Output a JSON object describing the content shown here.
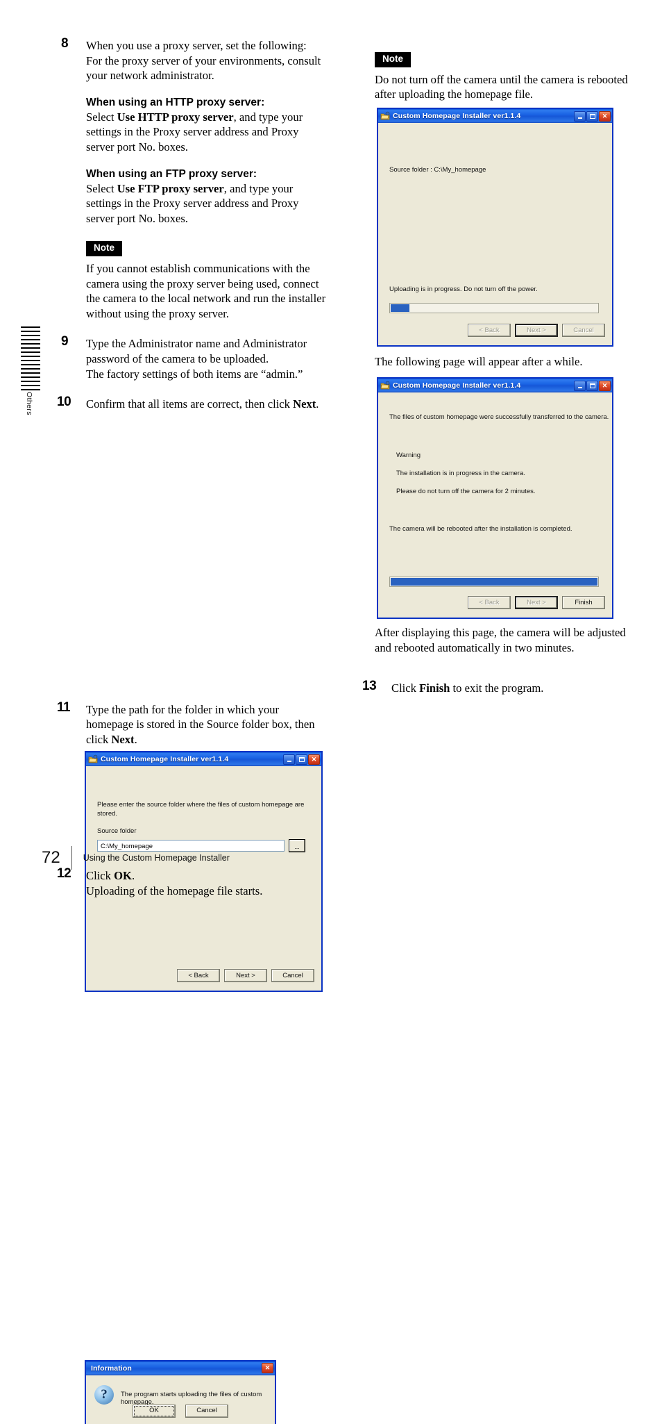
{
  "page": {
    "folio": "72",
    "running_title": "Using the Custom Homepage Installer",
    "thumb_tab_label": "Others"
  },
  "left_column": {
    "step8": {
      "number": "8",
      "intro_line1": "When you use a proxy server, set the following:",
      "intro_line2": "For the proxy server of your environments, consult",
      "intro_line3": "your network administrator.",
      "http_heading": "When using an HTTP proxy server:",
      "http_lead": "Select ",
      "http_bold": "Use HTTP proxy server",
      "http_rest": ", and type your settings in the Proxy server address and Proxy server port No. boxes.",
      "ftp_heading": "When using an FTP proxy server:",
      "ftp_lead": "Select ",
      "ftp_bold": "Use FTP proxy server",
      "ftp_rest": ", and type your settings in the Proxy server address and Proxy server port No. boxes.",
      "note_badge": "Note",
      "note_text": "If you cannot establish communications with the camera using the proxy server being used, connect the camera to the local network and run the installer without using the proxy server."
    },
    "step9": {
      "number": "9",
      "line1": "Type the Administrator name and Administrator password of the camera to be uploaded.",
      "line2": "The factory settings of both items are “admin.”"
    },
    "step10": {
      "number": "10",
      "text_before": "Confirm that all items are correct, then click ",
      "bold": "Next",
      "text_after": "."
    },
    "step11": {
      "number": "11",
      "text_before": "Type the path for the folder in which your homepage is stored in the Source folder box, then click ",
      "bold": "Next",
      "text_after": "."
    },
    "step12": {
      "number": "12",
      "line1_before": "Click ",
      "line1_bold": "OK",
      "line1_after": ".",
      "line2": "Uploading of the homepage file starts."
    }
  },
  "right_column": {
    "note": {
      "badge": "Note",
      "text": "Do not turn off the camera until the camera is rebooted after uploading the homepage file."
    },
    "caption_after_upload": "The following page will appear after a while.",
    "caption_after_finish": "After displaying this page, the camera will be adjusted and rebooted automatically in two minutes.",
    "step13": {
      "number": "13",
      "text_before": "Click ",
      "bold": "Finish",
      "text_after": " to exit the program."
    }
  },
  "dialogs": {
    "source": {
      "title": "Custom Homepage Installer  ver1.1.4",
      "instruction": "Please enter the source folder where the files of custom homepage are stored.",
      "field_label": "Source folder",
      "field_value": "C:\\My_homepage",
      "browse_label": "...",
      "buttons": {
        "back": "< Back",
        "next": "Next >",
        "cancel": "Cancel"
      }
    },
    "upload": {
      "title": "Custom Homepage Installer  ver1.1.4",
      "source_line": "Source folder : C:\\My_homepage",
      "status": "Uploading is in progress. Do not turn off the power.",
      "progress_percent": 9,
      "buttons": {
        "back": "< Back",
        "next": "Next >",
        "cancel": "Cancel"
      }
    },
    "finish": {
      "title": "Custom Homepage Installer  ver1.1.4",
      "success_line": "The files of custom homepage were successfully transferred to the camera.",
      "warning_label": "Warning",
      "warning_line1": "The installation is in progress in the camera.",
      "warning_line2": "Please do not turn off the camera for 2 minutes.",
      "reboot_line": "The camera will be rebooted after the installation is completed.",
      "progress_percent": 100,
      "buttons": {
        "back": "< Back",
        "next": "Next >",
        "finish": "Finish"
      }
    },
    "information": {
      "title": "Information",
      "icon": "question-mark-icon",
      "message": "The program starts uploading the files of custom homepage.",
      "buttons": {
        "ok": "OK",
        "cancel": "Cancel"
      }
    }
  },
  "colors": {
    "titlebar_blue": "#1a63e4",
    "dialog_face": "#ece9d8",
    "progress_blue": "#2a62c0",
    "close_red": "#e2522c"
  }
}
